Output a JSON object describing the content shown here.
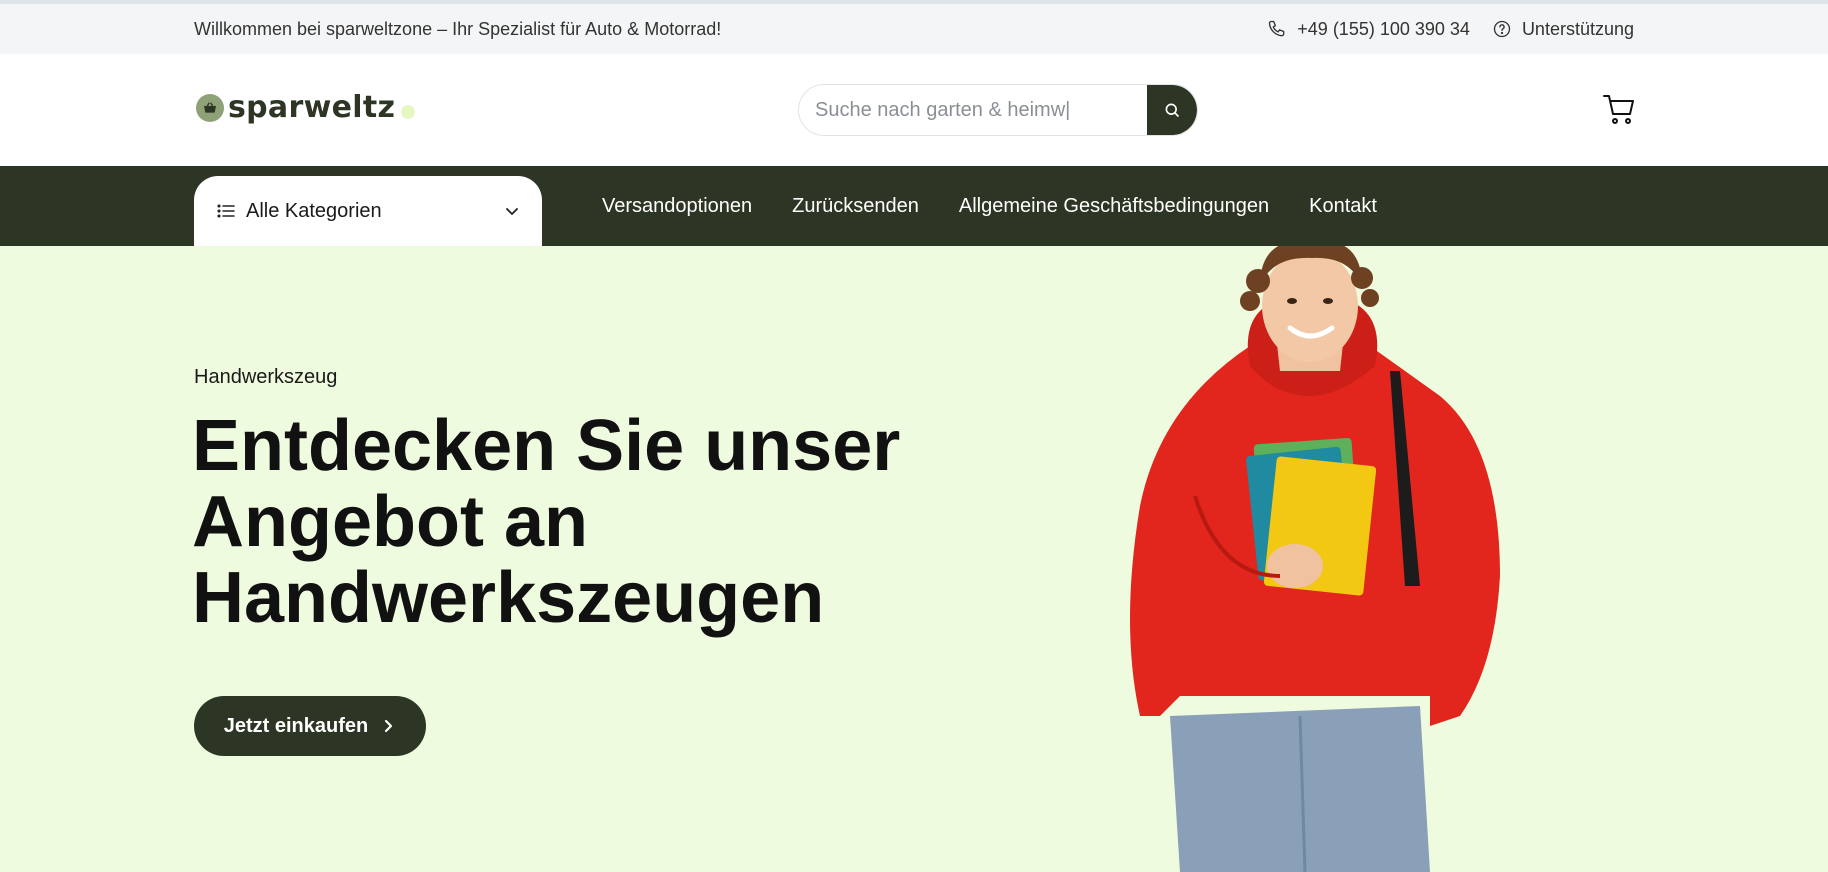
{
  "topbar": {
    "welcome": "Willkommen bei sparweltzone – Ihr Spezialist für Auto & Motorrad!",
    "phone": "+49 (155) 100 390 34",
    "support": "Unterstützung"
  },
  "header": {
    "logo_text": "sparweltz",
    "search_placeholder": "Suche nach garten & heimw|",
    "icons": [
      "phone-icon",
      "help-icon",
      "basket-icon",
      "search-icon",
      "cart-icon"
    ]
  },
  "nav": {
    "categories_label": "Alle Kategorien",
    "links": [
      "Versandoptionen",
      "Zurücksenden",
      "Allgemeine Geschäftsbedingungen",
      "Kontakt"
    ]
  },
  "hero": {
    "kicker": "Handwerkszeug",
    "title": "Entdecken Sie unser Angebot an Handwerkszeugen",
    "cta": "Jetzt einkaufen"
  },
  "colors": {
    "dark_green": "#2d3524",
    "hero_bg": "#effbdf",
    "hoodie_red": "#e2261d",
    "notebook_yellow": "#f2c812"
  }
}
